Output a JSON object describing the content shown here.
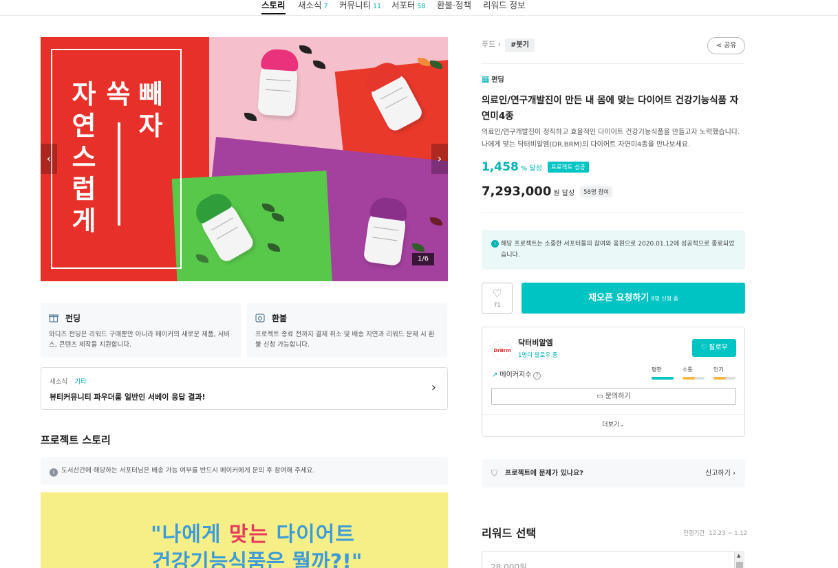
{
  "nav": {
    "tabs": [
      {
        "label": "스토리",
        "count": ""
      },
      {
        "label": "새소식",
        "count": "7"
      },
      {
        "label": "커뮤니티",
        "count": "11"
      },
      {
        "label": "서포터",
        "count": "58"
      },
      {
        "label": "환불·정책",
        "count": ""
      },
      {
        "label": "리워드 정보",
        "count": ""
      }
    ]
  },
  "hero": {
    "headline_col1": "자연스럽게",
    "headline_col2": "쏙",
    "headline_col3": "빼자",
    "counter": "1/6",
    "prev_glyph": "‹",
    "next_glyph": "›"
  },
  "cards": {
    "funding": {
      "title": "펀딩",
      "desc": "와디즈 펀딩은 리워드 구매뿐만 아니라 메이커의 새로운 제품, 서비스, 콘텐츠 제작을 지원합니다.",
      "icon": "gift-icon"
    },
    "refund": {
      "title": "환불",
      "desc": "프로젝트 종료 전까지 결제 취소 및 배송 지연과 리워드 문제 시 환불 신청 가능합니다.",
      "icon": "calendar-icon"
    }
  },
  "news": {
    "label": "새소식",
    "category": "기타",
    "title": "뷰티커뮤니티 파우더룸 일반인 서베이 응답 결과!"
  },
  "story": {
    "heading": "프로젝트 스토리",
    "notice": "도서산간에 해당하는 서포터님은 배송 가능 여부를 반드시 메이커에게 문의 후 참여해 주세요.",
    "image_line1_a": "\"나에게 ",
    "image_line1_em": "맞는",
    "image_line1_b": " 다이어트",
    "image_line2": "건강기능식품은 뭘까?!\""
  },
  "project": {
    "crumb": "푸드",
    "tag": "#붓기",
    "share": "공유",
    "kind": "펀딩",
    "title": "의료인/연구개발진이 만든 내 몸에 맞는 다이어트 건강기능식품 자연미4종",
    "desc": "의료인/연구개발진이 정직하고 효율적인 다이어트 건강기능식품을 만들고자 노력했습니다. 나에게 맞는 닥터비알엠(DR.BRM)의 다이어트 자연미4종을 만나보세요.",
    "rate": "1,458",
    "rate_unit": "% 달성",
    "success_badge": "프로젝트 성공",
    "amount": "7,293,000",
    "amount_unit": "원 달성",
    "participants": "58명 참여",
    "success_msg": "해당 프로젝트는 소중한 서포터들의 참여와 응원으로 2020.01.12에 성공적으로 종료되었습니다.",
    "likes": "71",
    "reopen": "재오픈 요청하기",
    "reopen_sub": "8명 신청 중"
  },
  "maker": {
    "logo_text": "DrBrm",
    "name": "닥터비알엠",
    "followers": "1명이 팔로우 중",
    "follow": "팔로우",
    "index_label": "메이커지수",
    "meters": [
      {
        "label": "평판",
        "level": 1.0,
        "color": "#00c4c4"
      },
      {
        "label": "소통",
        "level": 0.55,
        "color": "#f5b942"
      },
      {
        "label": "인기",
        "level": 0.55,
        "color": "#f5b942"
      }
    ],
    "inquiry": "문의하기",
    "more": "더보기"
  },
  "report": {
    "question": "프로젝트에 문제가 있나요?",
    "link": "신고하기"
  },
  "reward": {
    "heading": "리워드 선택",
    "period_label": "진행기간",
    "period": "12.23 ~ 1.12",
    "first_price": "28,000원"
  }
}
